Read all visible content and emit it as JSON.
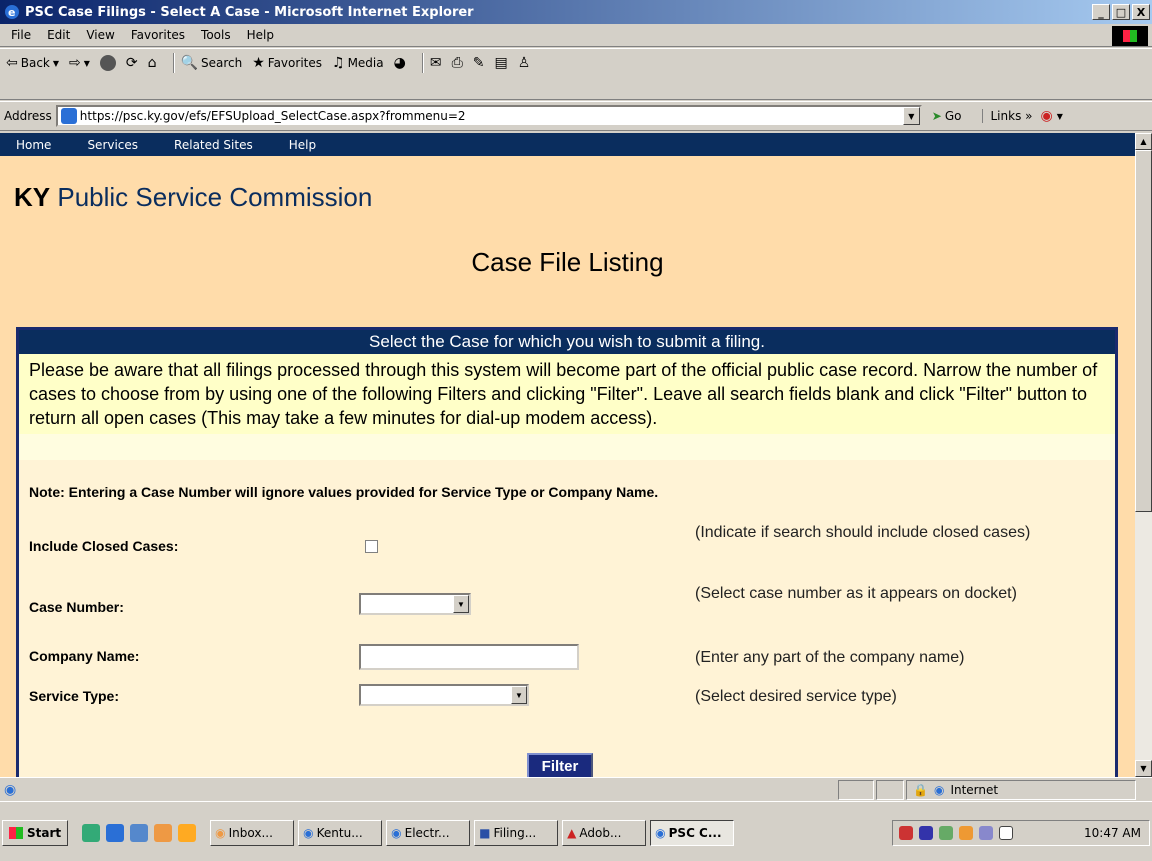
{
  "window": {
    "title": "PSC Case Filings - Select A Case - Microsoft Internet Explorer",
    "min": "_",
    "max": "в¡",
    "close": "X"
  },
  "menu": [
    "File",
    "Edit",
    "View",
    "Favorites",
    "Tools",
    "Help"
  ],
  "toolbar": {
    "back": "Back",
    "search": "Search",
    "favorites": "Favorites",
    "media": "Media"
  },
  "address": {
    "label": "Address",
    "url": "https://psc.ky.gov/efs/EFSUpload_SelectCase.aspx?frommenu=2",
    "go": "Go",
    "links": "Links"
  },
  "nav": [
    "Home",
    "Services",
    "Related Sites",
    "Help"
  ],
  "brand": {
    "prefix": "KY",
    "name": "Public Service Commission"
  },
  "page_title": "Case File Listing",
  "panel": {
    "header": "Select the Case for which you wish to submit a filing.",
    "notice": "Please be aware that all filings processed through this system will become part of the official public case record.  Narrow the number of cases to choose from by using one of the following Filters and clicking \"Filter\". Leave all search fields blank and click \"Filter\" button to return all open cases (This may take a few minutes for dial-up modem access).",
    "note": "Note: Entering a Case Number will ignore values provided for Service Type or Company Name.",
    "fields": {
      "closed_label": "Include Closed Cases:",
      "closed_hint": "(Indicate if search should include closed cases)",
      "case_label": "Case Number:",
      "case_hint": "(Select case number as it appears on docket)",
      "company_label": "Company Name:",
      "company_hint": "(Enter any part of the company name)",
      "service_label": "Service Type:",
      "service_hint": "(Select desired service type)"
    },
    "filter_button": "Filter"
  },
  "status": {
    "zone": "Internet"
  },
  "taskbar": {
    "start": "Start",
    "tasks": [
      "Inbox...",
      "Kentu...",
      "Electr...",
      "Filing...",
      "Adob...",
      "PSC C..."
    ],
    "clock": "10:47 AM"
  }
}
